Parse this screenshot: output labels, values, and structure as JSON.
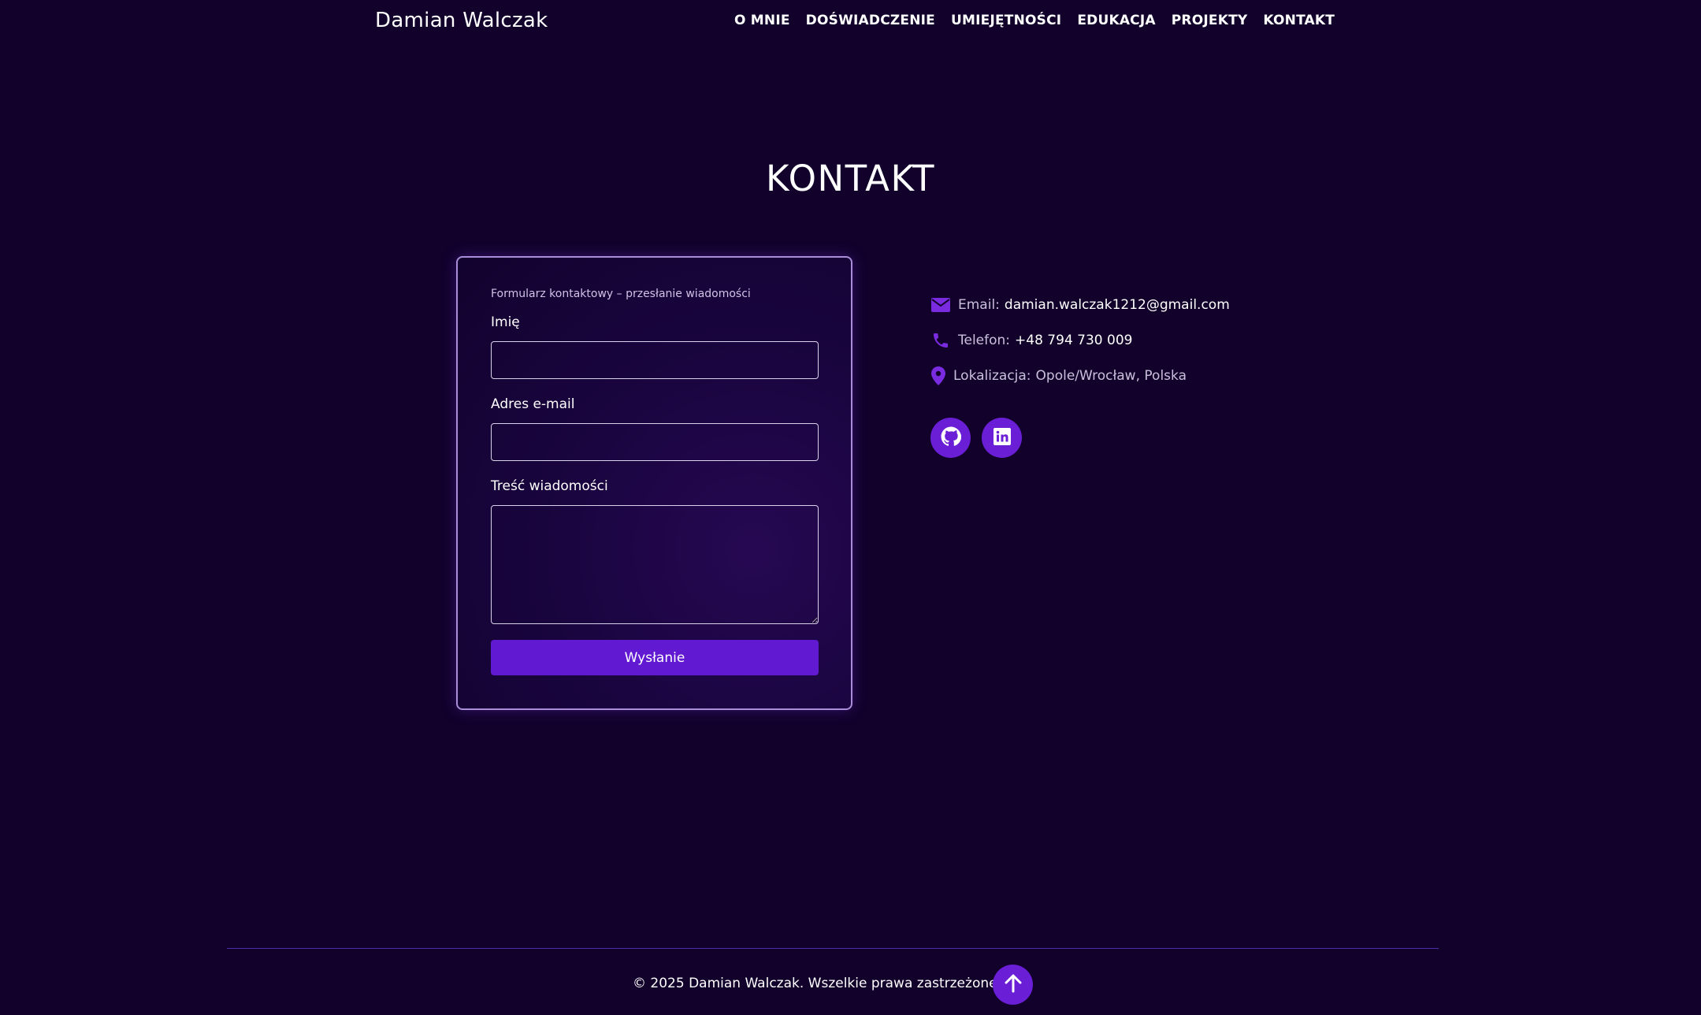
{
  "header": {
    "brand": "Damian Walczak",
    "nav": [
      "O MNIE",
      "DOŚWIADCZENIE",
      "UMIEJĘTNOŚCI",
      "EDUKACJA",
      "PROJEKTY",
      "KONTAKT"
    ]
  },
  "contact": {
    "title": "KONTAKT",
    "form": {
      "caption": "Formularz kontaktowy – przesłanie wiadomości",
      "name_label": "Imię",
      "name_value": "",
      "email_label": "Adres e-mail",
      "email_value": "",
      "message_label": "Treść wiadomości",
      "message_value": "",
      "submit_label": "Wysłanie"
    },
    "info": {
      "email_label": "Email:",
      "email_value": "damian.walczak1212@gmail.com",
      "phone_label": "Telefon:",
      "phone_value": "+48 794 730 009",
      "location_label": "Lokalizacja:",
      "location_value": "Opole/Wrocław, Polska"
    },
    "socials": [
      {
        "name": "github",
        "icon": "github-icon"
      },
      {
        "name": "linkedin",
        "icon": "linkedin-icon"
      }
    ]
  },
  "footer": {
    "copyright": "© 2025 Damian Walczak. Wszelkie prawa zastrzeżone.",
    "scroll_top_icon": "arrow-up-icon"
  },
  "colors": {
    "background": "#11012b",
    "accent": "#6119d1",
    "icon_accent": "#7a2be0"
  }
}
